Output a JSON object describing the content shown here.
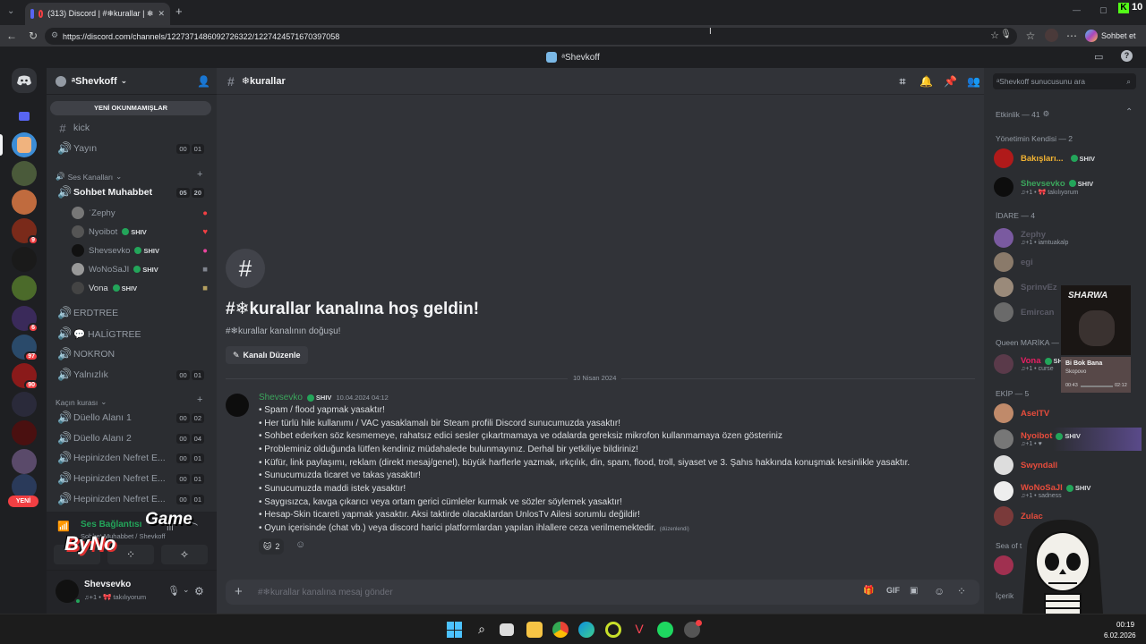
{
  "browser": {
    "tab_title": "(313) Discord | #❄kurallar | ❄",
    "url": "https://discord.com/channels/1227371486092726322/1227424571670397058",
    "sohbet_et": "Sohbet et",
    "k_badge": "10"
  },
  "title_bar": {
    "server_title": "ᵃShevkoff"
  },
  "server": {
    "name": "ᵃShevkoff"
  },
  "sidebar": {
    "unread_pill": "YENİ OKUNMAMIŞLAR",
    "new_pill": "YENİ",
    "channels_top": [
      {
        "name": "kick",
        "type": "text"
      },
      {
        "name": "Yayın",
        "type": "voice",
        "counts": [
          "00",
          "01"
        ]
      }
    ],
    "voice_category": "Ses Kanalları",
    "voice_active": {
      "name": "Sohbet Muhabbet",
      "counts": [
        "05",
        "20"
      ]
    },
    "voice_users": [
      {
        "name": "ˈZephy",
        "tag": ""
      },
      {
        "name": "Nyoibot",
        "tag": "SHIV"
      },
      {
        "name": "Shevsevko",
        "tag": "SHIV"
      },
      {
        "name": "WoNoSaJI",
        "tag": "SHIV"
      },
      {
        "name": "Vona",
        "tag": "SHIV"
      }
    ],
    "voice_rest": [
      {
        "name": "ERDTREE"
      },
      {
        "name": "💬 HALİGTREE"
      },
      {
        "name": "NOKRON"
      },
      {
        "name": "Yalnızlık",
        "counts": [
          "00",
          "01"
        ]
      }
    ],
    "escape_category": "Kaçın kurası",
    "escape_channels": [
      {
        "name": "Düello Alanı 1",
        "counts": [
          "00",
          "02"
        ]
      },
      {
        "name": "Düello Alanı 2",
        "counts": [
          "00",
          "04"
        ]
      },
      {
        "name": "Hepinizden Nefret E...",
        "counts": [
          "00",
          "01"
        ]
      },
      {
        "name": "Hepinizden Nefret E...",
        "counts": [
          "00",
          "01"
        ]
      },
      {
        "name": "Hepinizden Nefret E...",
        "counts": [
          "00",
          "01"
        ]
      }
    ],
    "voice_connected": "Ses Bağlantısı",
    "voice_connected_sub": "Sohbet Muhabbet / Shevkoff",
    "user": {
      "name": "Shevsevko",
      "status": "♫+1 • 🎀 takılıyorum"
    },
    "overlay_logo": "ByNo",
    "overlay_game": "Game"
  },
  "server_badges": [
    "9",
    "6",
    "97",
    "90"
  ],
  "channel": {
    "name": "❄kurallar",
    "welcome_title": "#❄kurallar kanalına hoş geldin!",
    "welcome_sub": "#❄kurallar kanalının doğuşu!",
    "edit_button": "Kanalı Düzenle",
    "date_divider": "10 Nisan 2024",
    "message": {
      "author": "Shevsevko",
      "tag": "SHIV",
      "timestamp": "10.04.2024 04:12",
      "lines": [
        "• Spam / flood yapmak yasaktır!",
        "• Her türlü hile kullanımı / VAC yasaklamalı bir Steam profili Discord sunucumuzda yasaktır!",
        "• Sohbet ederken söz kesmemeye, rahatsız edici sesler çıkartmamaya ve odalarda gereksiz mikrofon kullanmamaya özen gösteriniz",
        "• Probleminiz olduğunda lütfen kendiniz müdahalede bulunmayınız. Derhal bir yetkiliye bildiriniz!",
        "• Küfür, link paylaşımı, reklam (direkt mesaj/genel), büyük harflerle yazmak, ırkçılık, din, spam, flood, troll, siyaset ve 3. Şahıs hakkında konuşmak kesinlikle yasaktır.",
        "• Sunucumuzda ticaret ve takas yasaktır!",
        "• Sunucumuzda maddi istek yasaktır!",
        "• Saygısızca, kavga çıkarıcı veya ortam gerici cümleler kurmak ve sözler söylemek yasaktır!",
        "• Hesap-Skin ticareti yapmak yasaktır. Aksi taktirde olacaklardan UnlosTv Ailesi sorumlu değildir!",
        "• Oyun içerisinde (chat vb.) veya discord harici platformlardan yapılan ihlallere ceza verilmemektedir."
      ],
      "edited": "(düzenlendi)",
      "reaction_count": "2"
    },
    "composer_placeholder": "#❄kurallar kanalına mesaj gönder"
  },
  "members": {
    "search_placeholder": "ᵃShevkoff sunucusunu ara",
    "activity": "Etkinlik — 41",
    "groups": [
      {
        "label": "Yönetimin Kendisi — 2",
        "members": [
          {
            "name": "Bakışları...",
            "tag": "SHIV",
            "color": "#f0b232",
            "sub": ""
          },
          {
            "name": "Shevsevko",
            "tag": "SHIV",
            "color": "#3ba55c",
            "sub": "♫+1 • 🎀 takılıyorum"
          }
        ]
      },
      {
        "label": "İDARE — 4",
        "members": [
          {
            "name": "Zephy",
            "tag": "",
            "color": "#5a5a66",
            "sub": "♫+1 • iamtuakalp"
          },
          {
            "name": "egi",
            "tag": "",
            "color": "#5a5a66",
            "sub": ""
          },
          {
            "name": "SprinvEz",
            "tag": "",
            "color": "#5a5a66",
            "sub": ""
          },
          {
            "name": "Emircan",
            "tag": "",
            "color": "#5a5a66",
            "sub": ""
          }
        ]
      },
      {
        "label": "Queen MARİKA — 1",
        "members": [
          {
            "name": "Vona",
            "tag": "SHIV",
            "color": "#e91e63",
            "sub": "♫+1 • curse"
          }
        ]
      },
      {
        "label": "EKİP — 5",
        "members": [
          {
            "name": "AselTV",
            "tag": "",
            "color": "#e74c3c",
            "sub": ""
          },
          {
            "name": "Nyoibot",
            "tag": "SHIV",
            "color": "#e74c3c",
            "sub": "♫+1 • ♥"
          },
          {
            "name": "Swyndall",
            "tag": "",
            "color": "#e74c3c",
            "sub": ""
          },
          {
            "name": "WoNoSaJI",
            "tag": "SHIV",
            "color": "#e74c3c",
            "sub": "♫+1 • sadness"
          },
          {
            "name": "Zulac",
            "tag": "",
            "color": "#e74c3c",
            "sub": ""
          }
        ]
      }
    ],
    "sea_label": "Sea of t",
    "icerik_label": "İçerik",
    "music_card": {
      "title": "Bi Bok Bana",
      "artist": "Skopovo",
      "t_start": "00:43",
      "t_end": "02:12",
      "cover": "SHARWA"
    }
  },
  "taskbar": {
    "time": "00:19",
    "date": "6.02.2026"
  },
  "colors": {
    "accent": "#5865f2",
    "online": "#23a55a",
    "danger": "#f23f43",
    "author": "#3ba55c"
  }
}
